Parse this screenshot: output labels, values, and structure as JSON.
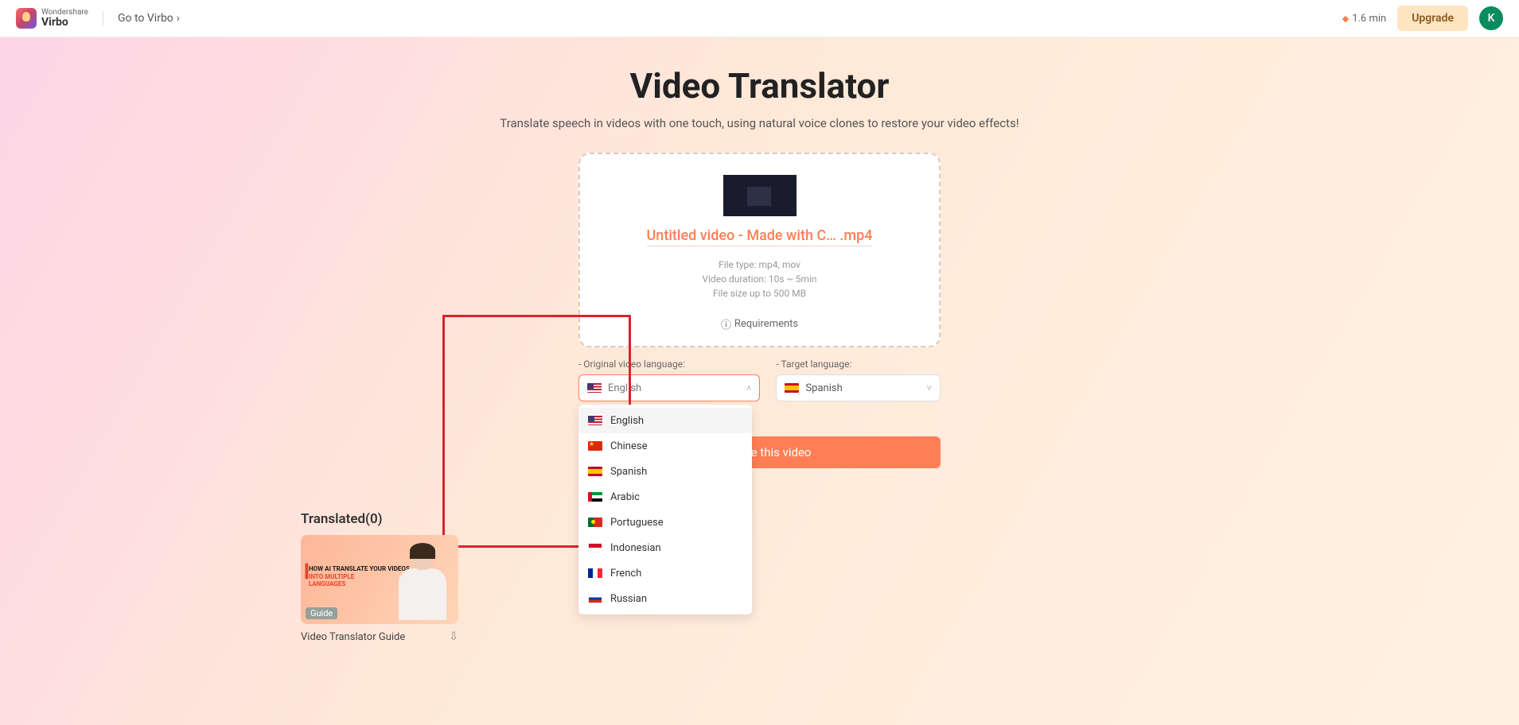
{
  "header": {
    "brand_top": "Wondershare",
    "brand_bottom": "Virbo",
    "go_link": "Go to Virbo",
    "minutes": "1.6 min",
    "upgrade": "Upgrade",
    "avatar_initial": "K"
  },
  "page": {
    "title": "Video Translator",
    "subtitle": "Translate speech in videos with one touch, using natural voice clones to restore your video effects!"
  },
  "upload": {
    "file_name": "Untitled video - Made with C… .mp4",
    "info_type": "File type: mp4, mov",
    "info_duration": "Video duration: 10s ~ 5min",
    "info_size": "File size up to 500 MB",
    "requirements": "Requirements"
  },
  "lang": {
    "original_label": "- Original video language:",
    "original_selected": "English",
    "original_placeholder": "English",
    "target_label": "- Target language:",
    "target_selected": "Spanish",
    "options": [
      {
        "label": "English",
        "flag": "flag-us"
      },
      {
        "label": "Chinese",
        "flag": "flag-cn"
      },
      {
        "label": "Spanish",
        "flag": "flag-es"
      },
      {
        "label": "Arabic",
        "flag": "flag-ae"
      },
      {
        "label": "Portuguese",
        "flag": "flag-pt"
      },
      {
        "label": "Indonesian",
        "flag": "flag-id"
      },
      {
        "label": "French",
        "flag": "flag-fr"
      },
      {
        "label": "Russian",
        "flag": "flag-ru"
      }
    ]
  },
  "action": {
    "translate": "Translate this video"
  },
  "translated": {
    "heading": "Translated(0)",
    "guide_badge": "Guide",
    "guide_title": "Video Translator Guide",
    "thumb_line1": "HOW AI TRANSLATE YOUR VIDEOS",
    "thumb_line2": "INTO MULTIPLE",
    "thumb_line3": "LANGUAGES"
  }
}
